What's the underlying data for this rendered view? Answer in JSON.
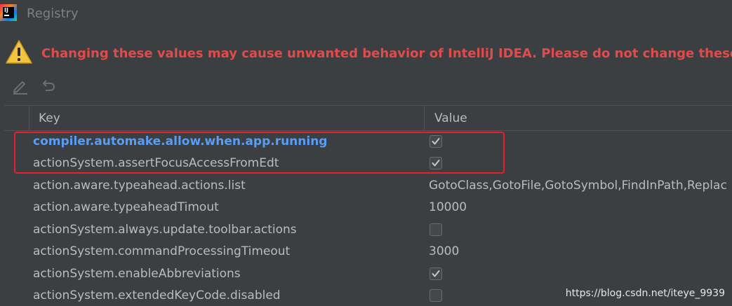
{
  "window": {
    "title": "Registry",
    "app_icon": "intellij-idea-icon"
  },
  "warning": {
    "icon": "warning-triangle-icon",
    "text": "Changing these values may cause unwanted behavior of IntelliJ IDEA. Please do not change these unless you h"
  },
  "toolbar": {
    "edit_icon": "pencil-icon",
    "revert_icon": "undo-icon"
  },
  "table": {
    "columns": [
      "Key",
      "Value"
    ],
    "rows": [
      {
        "key": "compiler.automake.allow.when.app.running",
        "type": "checkbox",
        "checked": true,
        "modified": true
      },
      {
        "key": "actionSystem.assertFocusAccessFromEdt",
        "type": "checkbox",
        "checked": true,
        "modified": false
      },
      {
        "key": "action.aware.typeahead.actions.list",
        "type": "text",
        "value": "GotoClass,GotoFile,GotoSymbol,FindInPath,Replac",
        "modified": false
      },
      {
        "key": "action.aware.typeaheadTimout",
        "type": "text",
        "value": "10000",
        "modified": false
      },
      {
        "key": "actionSystem.always.update.toolbar.actions",
        "type": "checkbox",
        "checked": false,
        "modified": false
      },
      {
        "key": "actionSystem.commandProcessingTimeout",
        "type": "text",
        "value": "3000",
        "modified": false
      },
      {
        "key": "actionSystem.enableAbbreviations",
        "type": "checkbox",
        "checked": true,
        "modified": false
      },
      {
        "key": "actionSystem.extendedKeyCode.disabled",
        "type": "checkbox",
        "checked": false,
        "modified": false
      }
    ]
  },
  "watermark": "https://blog.csdn.net/iteye_9939",
  "colors": {
    "background": "#3c3f41",
    "text": "#bbbbbb",
    "warning_text": "#e04b4b",
    "modified_key": "#589df6",
    "highlight_border": "#e8202a"
  }
}
